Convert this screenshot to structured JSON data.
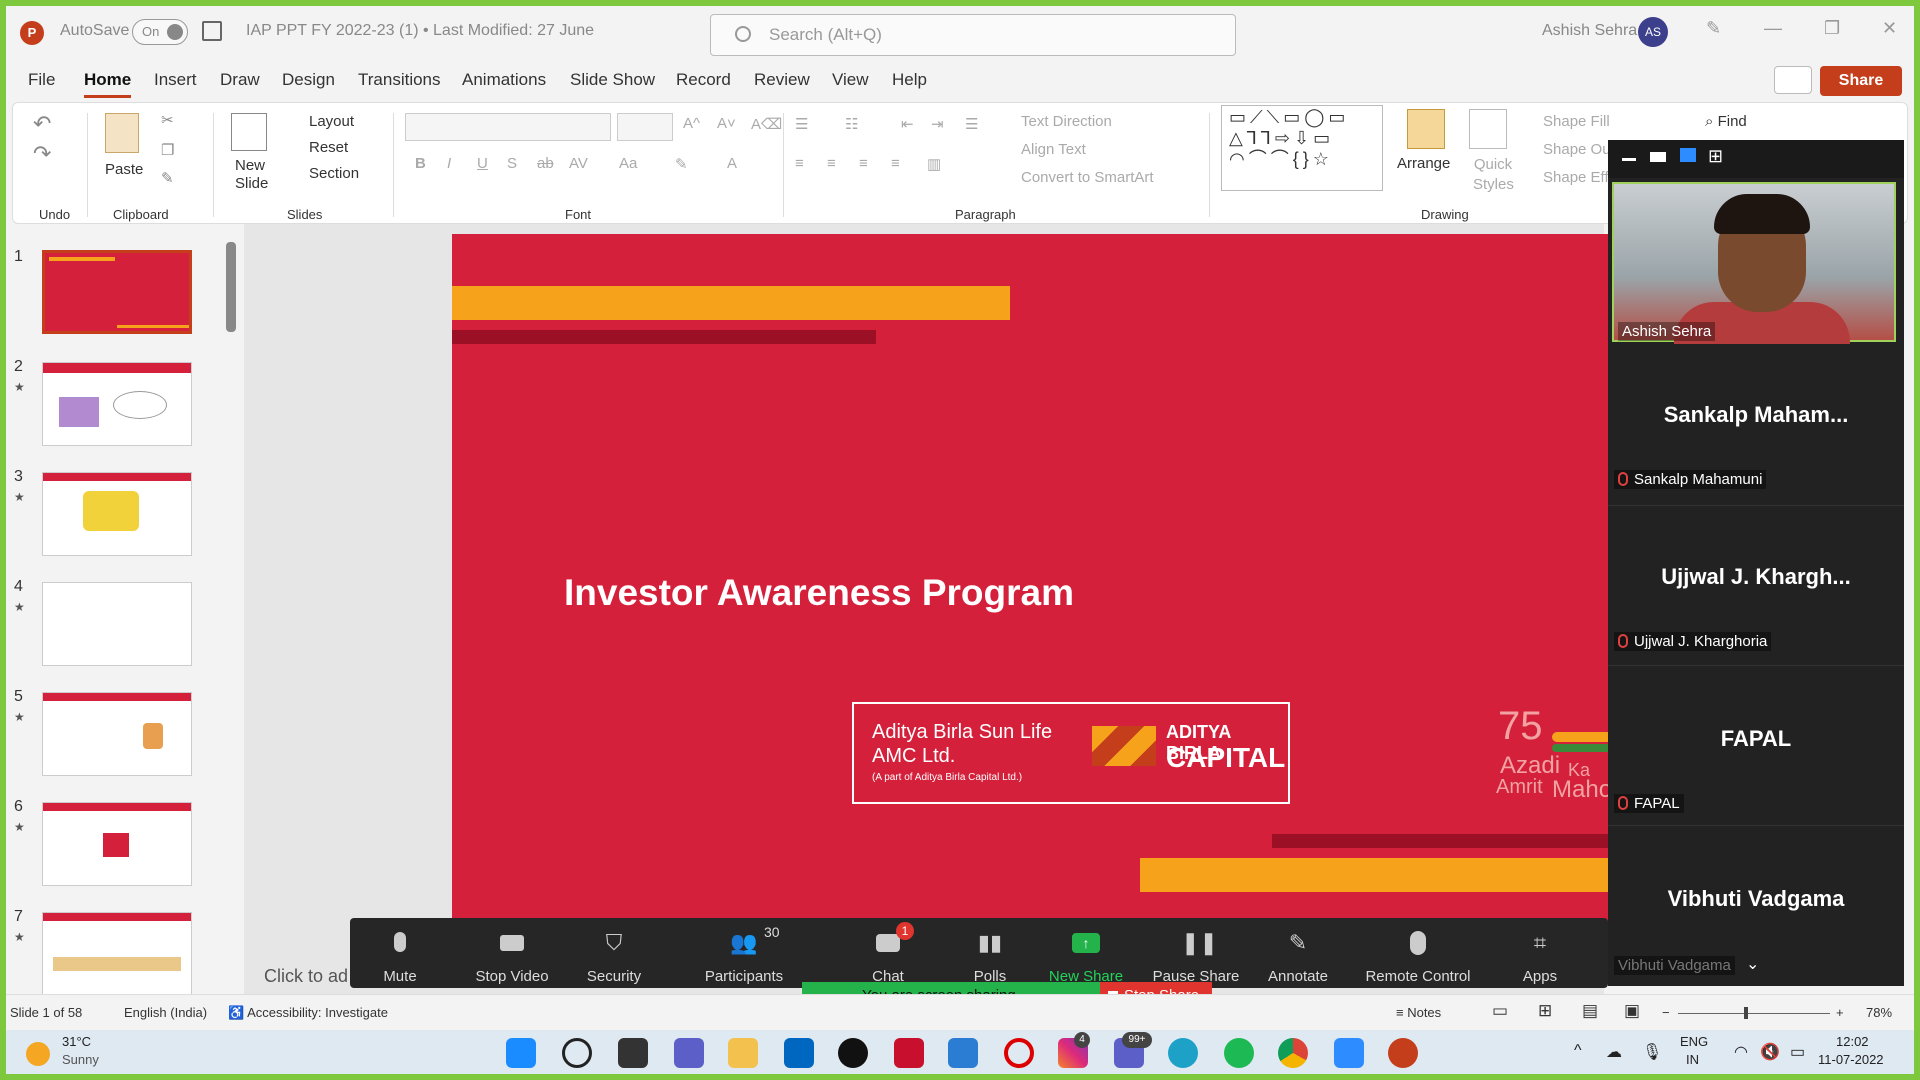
{
  "titlebar": {
    "app_icon": "P",
    "autosave_label": "AutoSave",
    "autosave_state": "On",
    "doc_title": "IAP PPT FY 2022-23 (1) • Last Modified: 27 June",
    "search_placeholder": "Search (Alt+Q)",
    "user_name": "Ashish Sehra",
    "user_initials": "AS",
    "minimize": "—",
    "restore": "❐",
    "close": "✕"
  },
  "menu": {
    "items": [
      "File",
      "Home",
      "Insert",
      "Draw",
      "Design",
      "Transitions",
      "Animations",
      "Slide Show",
      "Record",
      "Review",
      "View",
      "Help"
    ],
    "share_label": "Share"
  },
  "ribbon": {
    "undo_group": "Undo",
    "clipboard_group": "Clipboard",
    "paste_label": "Paste",
    "slides_group": "Slides",
    "new_slide_label": "New Slide",
    "layout_label": "Layout",
    "reset_label": "Reset",
    "section_label": "Section",
    "font_group": "Font",
    "paragraph_group": "Paragraph",
    "text_direction": "Text Direction",
    "align_text": "Align Text",
    "convert_smartart": "Convert to SmartArt",
    "drawing_group": "Drawing",
    "arrange_label": "Arrange",
    "quick_styles_label": "Quick Styles",
    "shape_fill": "Shape Fill",
    "shape_outline": "Shape Out",
    "shape_effects": "Shape Effe",
    "find_label": "Find"
  },
  "slides": {
    "numbers": [
      "1",
      "2",
      "3",
      "4",
      "5",
      "6",
      "7"
    ],
    "selected": 1
  },
  "slide": {
    "title": "Investor Awareness Program",
    "logo_line1": "Aditya Birla Sun Life",
    "logo_line2": "AMC Ltd.",
    "logo_sub": "(A part of Aditya Birla Capital Ltd.)",
    "capital_top": "ADITYA BIRLA",
    "capital_bottom": "CAPITAL",
    "azadi_75": "75",
    "azadi": "Azadi",
    "ka": "Ka",
    "amrit": "Amrit",
    "mahotsav": "Maho"
  },
  "editor": {
    "click_to_add": "Click to ad"
  },
  "zoom_toolbar": {
    "mute": "Mute",
    "stop_video": "Stop Video",
    "security": "Security",
    "participants": "Participants",
    "participants_count": "30",
    "chat": "Chat",
    "chat_badge": "1",
    "polls": "Polls",
    "new_share": "New Share",
    "pause_share": "Pause Share",
    "annotate": "Annotate",
    "remote_control": "Remote Control",
    "apps": "Apps"
  },
  "zoom_panel": {
    "video_name": "Ashish Sehra",
    "participants": [
      {
        "display": "Sankalp  Maham...",
        "tag": "Sankalp Mahamuni"
      },
      {
        "display": "Ujjwal  J.  Khargh...",
        "tag": "Ujjwal J. Kharghoria"
      },
      {
        "display": "FAPAL",
        "tag": "FAPAL"
      },
      {
        "display": "Vibhuti Vadgama",
        "tag": "Vibhuti Vadgama"
      }
    ]
  },
  "share_status": {
    "sharing": "You are screen sharing",
    "stop": "Stop Share"
  },
  "statusbar": {
    "slide_count": "Slide 1 of 58",
    "language": "English (India)",
    "accessibility": "Accessibility: Investigate",
    "notes": "Notes",
    "zoom_level": "78%"
  },
  "taskbar": {
    "weather_temp": "31°C",
    "weather_desc": "Sunny",
    "lang1": "ENG",
    "lang2": "IN",
    "time": "12:02",
    "date": "11-07-2022",
    "instagram_badge": "4",
    "teams_badge": "99+"
  },
  "colors": {
    "accent": "#c43e1c",
    "slide_bg": "#d4203a",
    "slide_orange": "#f6a21a",
    "slide_dark": "#9b1024",
    "zoom_green": "#23b34a",
    "zoom_red": "#e0342e"
  }
}
